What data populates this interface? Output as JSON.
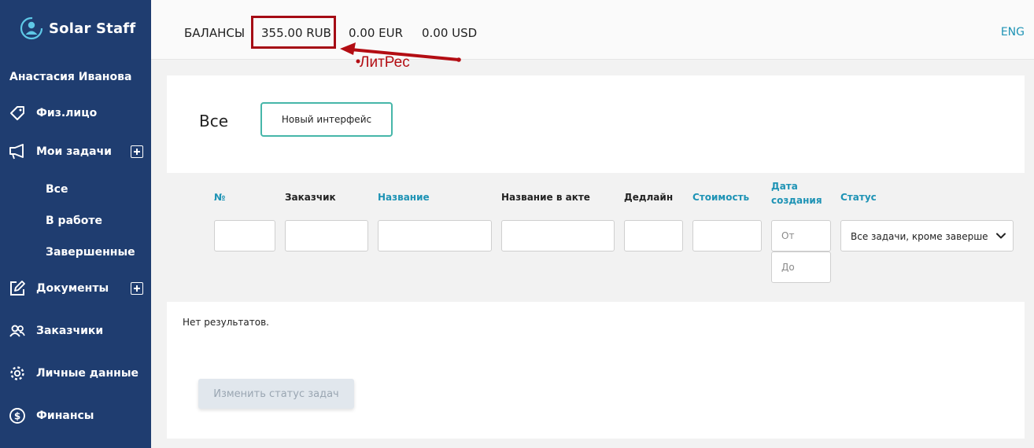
{
  "app": {
    "logo_text": "Solar Staff"
  },
  "sidebar": {
    "user_name": "Анастасия Иванова",
    "items": [
      {
        "label": "Физ.лицо",
        "icon": "tag-icon"
      },
      {
        "label": "Мои задачи",
        "icon": "megaphone-icon"
      },
      {
        "label": "Документы",
        "icon": "edit-icon"
      },
      {
        "label": "Заказчики",
        "icon": "users-icon"
      },
      {
        "label": "Личные данные",
        "icon": "gear-icon"
      },
      {
        "label": "Финансы",
        "icon": "dollar-icon"
      }
    ],
    "tasks_sub": [
      "Все",
      "В работе",
      "Завершенные"
    ]
  },
  "header": {
    "balances_label": "БАЛАНСЫ",
    "rub": "355.00 RUB",
    "eur": "0.00 EUR",
    "usd": "0.00 USD",
    "lang": "ENG",
    "annotation": "ЛитРес",
    "highlight_color": "#a50b15"
  },
  "main": {
    "title": "Все",
    "new_interface_button": "Новый интерфейс",
    "columns": {
      "num": "№",
      "customer": "Заказчик",
      "name": "Название",
      "act_name": "Название в акте",
      "deadline": "Дедлайн",
      "cost": "Стоимость",
      "created_line1": "Дата",
      "created_line2": "создания",
      "status": "Статус"
    },
    "date_from_placeholder": "От",
    "date_to_placeholder": "До",
    "status_value": "Все задачи, кроме завершенных",
    "no_results": "Нет результатов.",
    "change_status_button": "Изменить статус задач"
  },
  "colors": {
    "sidebar": "#1f3d70",
    "accent": "#1e93b5",
    "button_border": "#46b6a9"
  }
}
